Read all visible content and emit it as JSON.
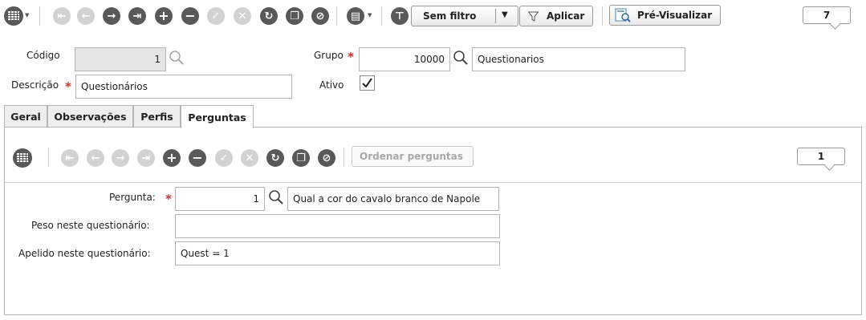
{
  "toolbar": {
    "filter_label": "Sem filtro",
    "apply_label": "Aplicar",
    "preview_label": "Pré-Visualizar",
    "record_count": "7"
  },
  "form": {
    "codigo_label": "Código",
    "codigo_value": "1",
    "grupo_label": "Grupo",
    "grupo_value": "10000",
    "grupo_desc": "Questionarios",
    "descricao_label": "Descrição",
    "descricao_value": "Questionários",
    "ativo_label": "Ativo",
    "ativo_checked": true
  },
  "tabs": [
    {
      "label": "Geral"
    },
    {
      "label": "Observações"
    },
    {
      "label": "Perfis"
    },
    {
      "label": "Perguntas"
    }
  ],
  "active_tab": "Perguntas",
  "subtoolbar": {
    "order_label": "Ordenar perguntas",
    "record_count": "1"
  },
  "detail": {
    "pergunta_label": "Pergunta:",
    "pergunta_value": "1",
    "pergunta_desc": "Qual a cor do cavalo branco de Napole",
    "peso_label": "Peso neste questionário:",
    "peso_value": "",
    "apelido_label": "Apelido neste questionário:",
    "apelido_value": "Quest = 1"
  }
}
